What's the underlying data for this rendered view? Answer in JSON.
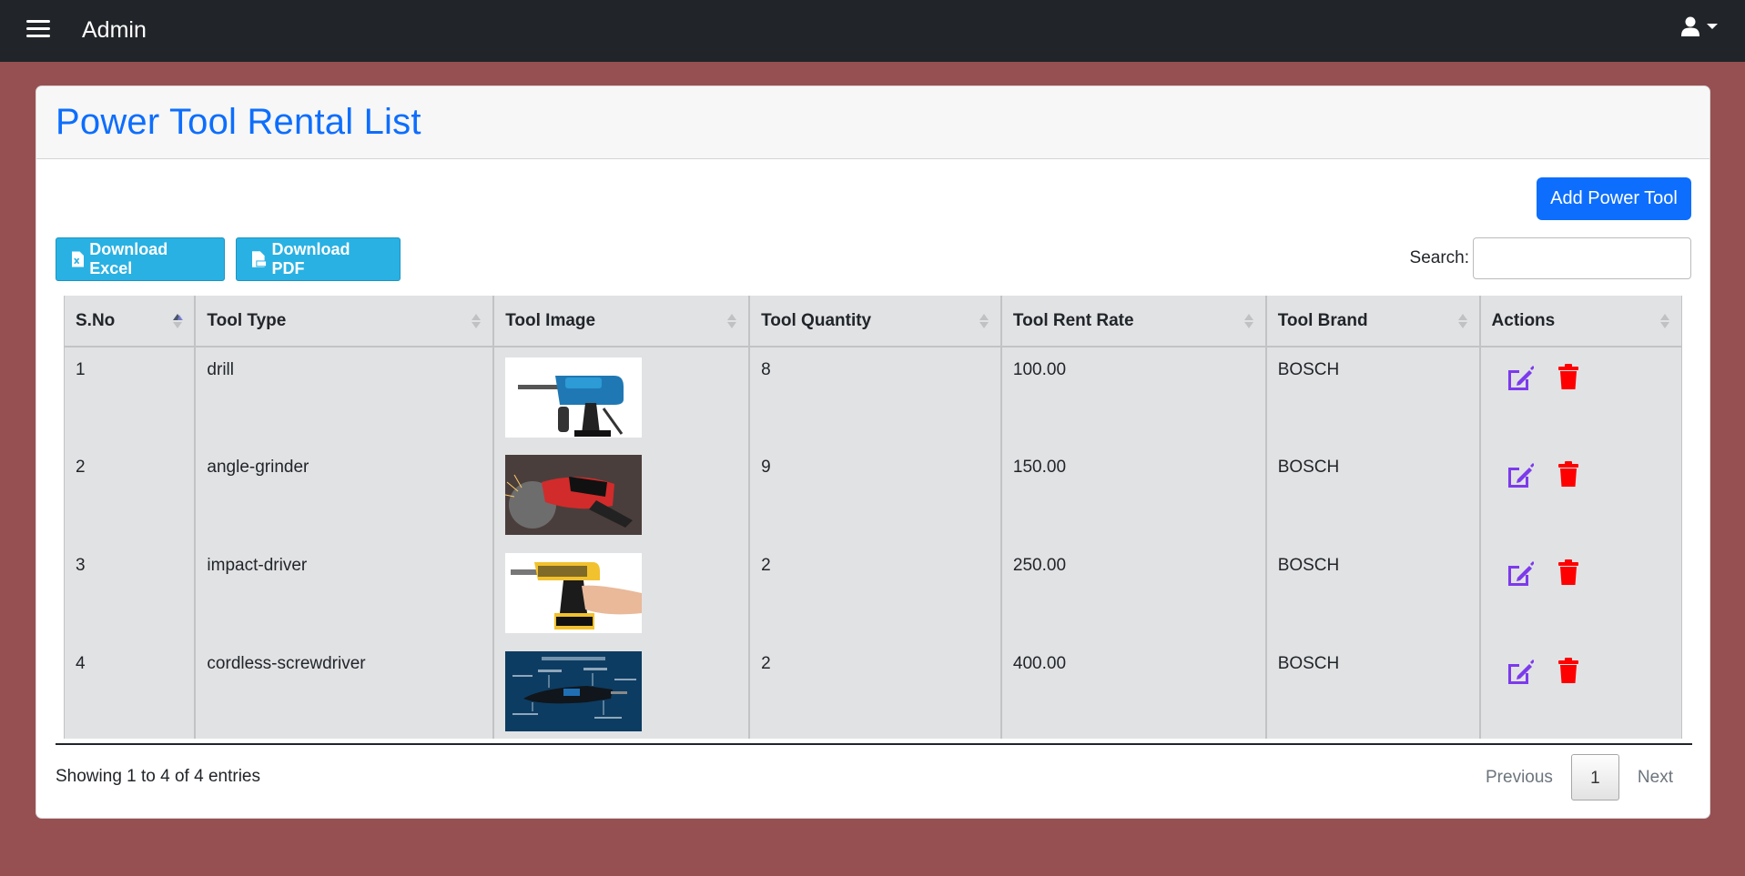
{
  "navbar": {
    "brand": "Admin",
    "menu_icon": "hamburger-icon",
    "user_icon": "user-icon"
  },
  "page": {
    "title": "Power Tool Rental List",
    "add_button": "Add Power Tool",
    "download_excel": "Download Excel",
    "download_pdf": "Download PDF",
    "search_label": "Search:",
    "search_value": ""
  },
  "table": {
    "columns": [
      "S.No",
      "Tool Type",
      "Tool Image",
      "Tool Quantity",
      "Tool Rent Rate",
      "Tool Brand",
      "Actions"
    ],
    "rows": [
      {
        "sno": "1",
        "type": "drill",
        "image": "drill-photo",
        "quantity": "8",
        "rate": "100.00",
        "brand": "BOSCH"
      },
      {
        "sno": "2",
        "type": "angle-grinder",
        "image": "angle-grinder-photo",
        "quantity": "9",
        "rate": "150.00",
        "brand": "BOSCH"
      },
      {
        "sno": "3",
        "type": "impact-driver",
        "image": "impact-driver-photo",
        "quantity": "2",
        "rate": "250.00",
        "brand": "BOSCH"
      },
      {
        "sno": "4",
        "type": "cordless-screwdriver",
        "image": "cordless-screwdriver-photo",
        "quantity": "2",
        "rate": "400.00",
        "brand": "BOSCH"
      }
    ],
    "action_icons": [
      "edit-icon",
      "trash-icon"
    ]
  },
  "footer": {
    "info": "Showing 1 to 4 of 4 entries",
    "previous": "Previous",
    "current_page": "1",
    "next": "Next"
  },
  "colors": {
    "background": "#975052",
    "navbar": "#212529",
    "primary": "#0d6efd",
    "export_button": "#29b1e3",
    "edit_icon": "#7c3aed",
    "delete_icon": "#ff0000"
  }
}
